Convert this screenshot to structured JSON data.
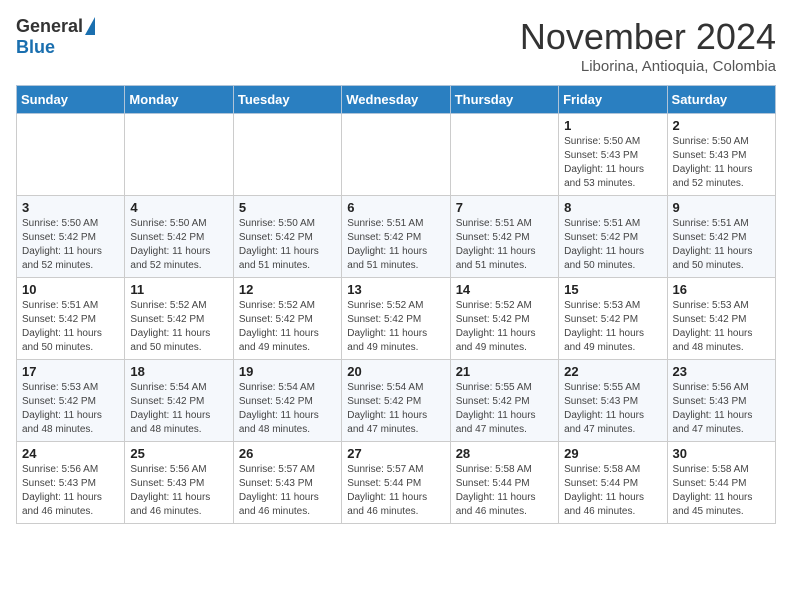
{
  "header": {
    "logo_general": "General",
    "logo_blue": "Blue",
    "month_title": "November 2024",
    "location": "Liborina, Antioquia, Colombia"
  },
  "days_of_week": [
    "Sunday",
    "Monday",
    "Tuesday",
    "Wednesday",
    "Thursday",
    "Friday",
    "Saturday"
  ],
  "weeks": [
    [
      {
        "day": "",
        "info": ""
      },
      {
        "day": "",
        "info": ""
      },
      {
        "day": "",
        "info": ""
      },
      {
        "day": "",
        "info": ""
      },
      {
        "day": "",
        "info": ""
      },
      {
        "day": "1",
        "info": "Sunrise: 5:50 AM\nSunset: 5:43 PM\nDaylight: 11 hours\nand 53 minutes."
      },
      {
        "day": "2",
        "info": "Sunrise: 5:50 AM\nSunset: 5:43 PM\nDaylight: 11 hours\nand 52 minutes."
      }
    ],
    [
      {
        "day": "3",
        "info": "Sunrise: 5:50 AM\nSunset: 5:42 PM\nDaylight: 11 hours\nand 52 minutes."
      },
      {
        "day": "4",
        "info": "Sunrise: 5:50 AM\nSunset: 5:42 PM\nDaylight: 11 hours\nand 52 minutes."
      },
      {
        "day": "5",
        "info": "Sunrise: 5:50 AM\nSunset: 5:42 PM\nDaylight: 11 hours\nand 51 minutes."
      },
      {
        "day": "6",
        "info": "Sunrise: 5:51 AM\nSunset: 5:42 PM\nDaylight: 11 hours\nand 51 minutes."
      },
      {
        "day": "7",
        "info": "Sunrise: 5:51 AM\nSunset: 5:42 PM\nDaylight: 11 hours\nand 51 minutes."
      },
      {
        "day": "8",
        "info": "Sunrise: 5:51 AM\nSunset: 5:42 PM\nDaylight: 11 hours\nand 50 minutes."
      },
      {
        "day": "9",
        "info": "Sunrise: 5:51 AM\nSunset: 5:42 PM\nDaylight: 11 hours\nand 50 minutes."
      }
    ],
    [
      {
        "day": "10",
        "info": "Sunrise: 5:51 AM\nSunset: 5:42 PM\nDaylight: 11 hours\nand 50 minutes."
      },
      {
        "day": "11",
        "info": "Sunrise: 5:52 AM\nSunset: 5:42 PM\nDaylight: 11 hours\nand 50 minutes."
      },
      {
        "day": "12",
        "info": "Sunrise: 5:52 AM\nSunset: 5:42 PM\nDaylight: 11 hours\nand 49 minutes."
      },
      {
        "day": "13",
        "info": "Sunrise: 5:52 AM\nSunset: 5:42 PM\nDaylight: 11 hours\nand 49 minutes."
      },
      {
        "day": "14",
        "info": "Sunrise: 5:52 AM\nSunset: 5:42 PM\nDaylight: 11 hours\nand 49 minutes."
      },
      {
        "day": "15",
        "info": "Sunrise: 5:53 AM\nSunset: 5:42 PM\nDaylight: 11 hours\nand 49 minutes."
      },
      {
        "day": "16",
        "info": "Sunrise: 5:53 AM\nSunset: 5:42 PM\nDaylight: 11 hours\nand 48 minutes."
      }
    ],
    [
      {
        "day": "17",
        "info": "Sunrise: 5:53 AM\nSunset: 5:42 PM\nDaylight: 11 hours\nand 48 minutes."
      },
      {
        "day": "18",
        "info": "Sunrise: 5:54 AM\nSunset: 5:42 PM\nDaylight: 11 hours\nand 48 minutes."
      },
      {
        "day": "19",
        "info": "Sunrise: 5:54 AM\nSunset: 5:42 PM\nDaylight: 11 hours\nand 48 minutes."
      },
      {
        "day": "20",
        "info": "Sunrise: 5:54 AM\nSunset: 5:42 PM\nDaylight: 11 hours\nand 47 minutes."
      },
      {
        "day": "21",
        "info": "Sunrise: 5:55 AM\nSunset: 5:42 PM\nDaylight: 11 hours\nand 47 minutes."
      },
      {
        "day": "22",
        "info": "Sunrise: 5:55 AM\nSunset: 5:43 PM\nDaylight: 11 hours\nand 47 minutes."
      },
      {
        "day": "23",
        "info": "Sunrise: 5:56 AM\nSunset: 5:43 PM\nDaylight: 11 hours\nand 47 minutes."
      }
    ],
    [
      {
        "day": "24",
        "info": "Sunrise: 5:56 AM\nSunset: 5:43 PM\nDaylight: 11 hours\nand 46 minutes."
      },
      {
        "day": "25",
        "info": "Sunrise: 5:56 AM\nSunset: 5:43 PM\nDaylight: 11 hours\nand 46 minutes."
      },
      {
        "day": "26",
        "info": "Sunrise: 5:57 AM\nSunset: 5:43 PM\nDaylight: 11 hours\nand 46 minutes."
      },
      {
        "day": "27",
        "info": "Sunrise: 5:57 AM\nSunset: 5:44 PM\nDaylight: 11 hours\nand 46 minutes."
      },
      {
        "day": "28",
        "info": "Sunrise: 5:58 AM\nSunset: 5:44 PM\nDaylight: 11 hours\nand 46 minutes."
      },
      {
        "day": "29",
        "info": "Sunrise: 5:58 AM\nSunset: 5:44 PM\nDaylight: 11 hours\nand 46 minutes."
      },
      {
        "day": "30",
        "info": "Sunrise: 5:58 AM\nSunset: 5:44 PM\nDaylight: 11 hours\nand 45 minutes."
      }
    ]
  ]
}
